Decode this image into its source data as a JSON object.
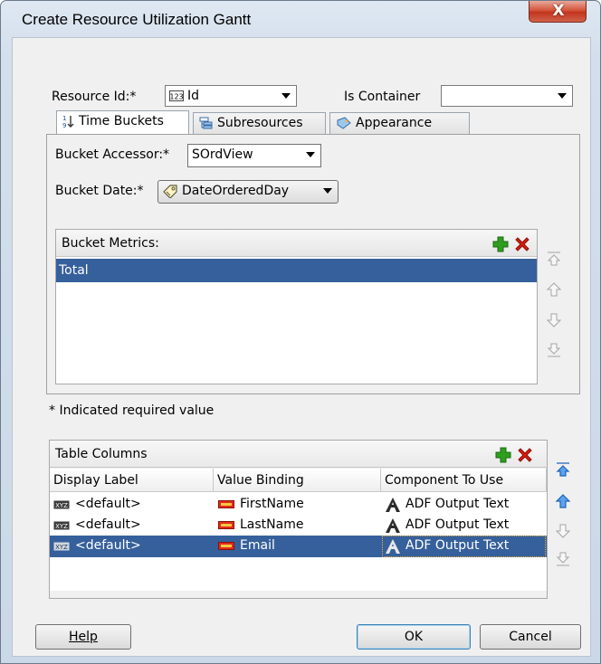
{
  "dialog": {
    "title": "Create Resource Utilization Gantt",
    "close_label": "X"
  },
  "resource": {
    "id_label": "Resource Id:*",
    "id_value": "Id",
    "id_value_icon": "123-number-icon",
    "container_label": "Is Container",
    "container_value": ""
  },
  "tabs": [
    {
      "label": "Time Buckets",
      "icon": "sort-numeric-icon",
      "active": true
    },
    {
      "label": "Subresources",
      "icon": "subresources-icon",
      "active": false
    },
    {
      "label": "Appearance",
      "icon": "paint-tag-icon",
      "active": false
    }
  ],
  "time_buckets": {
    "accessor_label": "Bucket Accessor:*",
    "accessor_value": "SOrdView",
    "date_label": "Bucket Date:*",
    "date_value": "DateOrderedDay",
    "date_value_icon": "tag-icon",
    "metrics_header": "Bucket Metrics:",
    "metrics": [
      "Total"
    ],
    "selected_metric": 0
  },
  "required_note": "* Indicated required value",
  "table_columns": {
    "header": "Table Columns",
    "columns": [
      "Display Label",
      "Value Binding",
      "Component To Use"
    ],
    "rows": [
      {
        "label": "<default>",
        "binding": "FirstName",
        "component": "ADF Output Text"
      },
      {
        "label": "<default>",
        "binding": "LastName",
        "component": "ADF Output Text"
      },
      {
        "label": "<default>",
        "binding": "Email",
        "component": "ADF Output Text"
      }
    ],
    "selected_row": 2
  },
  "footer": {
    "help_label": "Help",
    "ok_label": "OK",
    "cancel_label": "Cancel"
  },
  "colors": {
    "selection": "#36609b",
    "add": "#2f9e1f",
    "delete": "#d91c0e",
    "nav_active": "#2f7fd8"
  }
}
